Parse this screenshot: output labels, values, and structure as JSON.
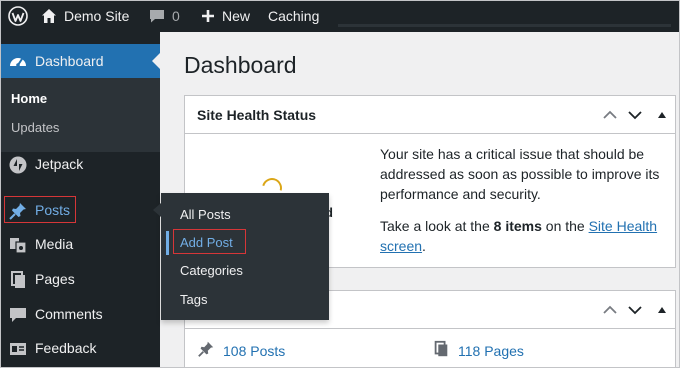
{
  "admin_bar": {
    "site_name": "Demo Site",
    "comments_count": "0",
    "new_label": "New",
    "caching_label": "Caching"
  },
  "sidebar": {
    "dashboard_label": "Dashboard",
    "home_label": "Home",
    "updates_label": "Updates",
    "items": [
      {
        "label": "Jetpack"
      },
      {
        "label": "Posts"
      },
      {
        "label": "Media"
      },
      {
        "label": "Pages"
      },
      {
        "label": "Comments"
      },
      {
        "label": "Feedback"
      }
    ]
  },
  "flyout": {
    "items": [
      {
        "label": "All Posts"
      },
      {
        "label": "Add Post"
      },
      {
        "label": "Categories"
      },
      {
        "label": "Tags"
      }
    ]
  },
  "main": {
    "title": "Dashboard",
    "site_health": {
      "title": "Site Health Status",
      "status_fragment": "d",
      "message": "Your site has a critical issue that should be addressed as soon as possible to improve its performance and security.",
      "take_look_prefix": "Take a look at the ",
      "items_count": "8 items",
      "on_the": " on the ",
      "link_text": "Site Health screen",
      "suffix": "."
    },
    "at_a_glance": {
      "posts": "108 Posts",
      "pages": "118 Pages"
    }
  },
  "colors": {
    "admin_dark": "#1d2327",
    "submenu_dark": "#2c3338",
    "accent_blue": "#2271b1",
    "highlight_red": "#d63638",
    "flyout_link": "#72aee6"
  },
  "icons": {
    "wp_logo": "wordpress-icon",
    "comments": "comment-bubble-icon",
    "new": "plus-icon",
    "dashboard": "gauge-icon",
    "jetpack": "jetpack-bolt-icon",
    "posts": "pushpin-icon",
    "media": "media-icon",
    "pages": "pages-icon",
    "comments_menu": "comment-bubble-icon",
    "feedback": "feedback-icon"
  }
}
